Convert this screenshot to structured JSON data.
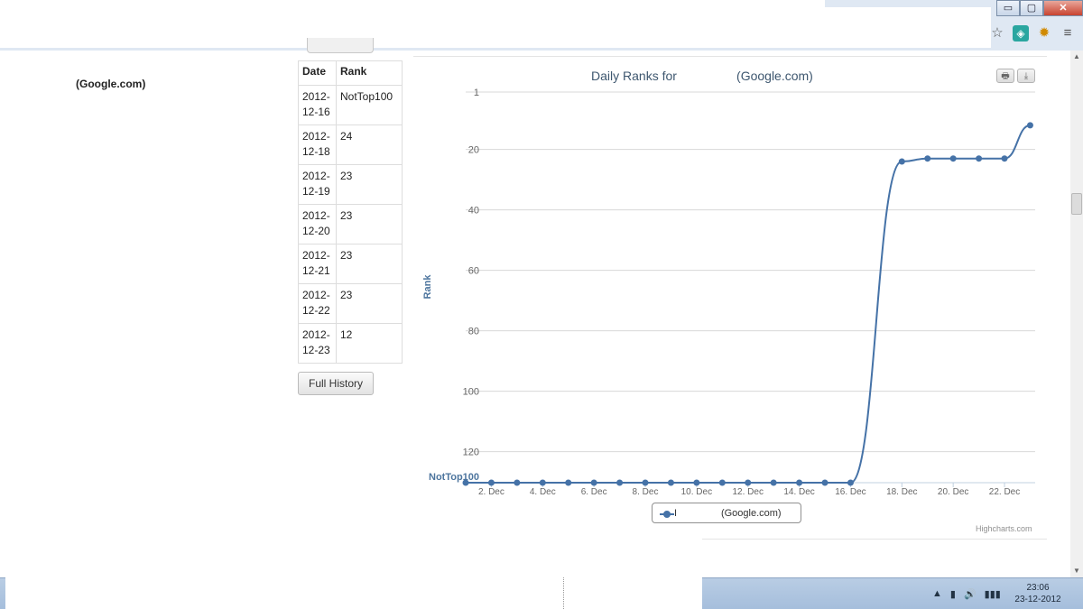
{
  "window": {
    "minimize": "▭",
    "maximize": "▢",
    "close": "✕"
  },
  "toolbar": {
    "star_icon": "☆",
    "ext1_icon": "◈",
    "ext2_icon": "✹",
    "menu_icon": "≡"
  },
  "page": {
    "title": "(Google.com)"
  },
  "table": {
    "headers": [
      "Date",
      "Rank"
    ],
    "rows": [
      [
        "2012-\n12-16",
        "NotTop100"
      ],
      [
        "2012-\n12-18",
        "24"
      ],
      [
        "2012-\n12-19",
        "23"
      ],
      [
        "2012-\n12-20",
        "23"
      ],
      [
        "2012-\n12-21",
        "23"
      ],
      [
        "2012-\n12-22",
        "23"
      ],
      [
        "2012-\n12-23",
        "12"
      ]
    ]
  },
  "buttons": {
    "full_history": "Full History"
  },
  "chart_buttons": {
    "print_icon": "🖶",
    "download_icon": "⤓"
  },
  "chart_data": {
    "type": "line",
    "title": "Daily Ranks for                 (Google.com)",
    "ylabel": "Rank",
    "y_reversed": true,
    "y_ticks": [
      "1",
      "20",
      "40",
      "60",
      "80",
      "100",
      "120"
    ],
    "y_tick_values": [
      1,
      20,
      40,
      60,
      80,
      100,
      120
    ],
    "not_top_label": "NotTop100",
    "x_tick_labels": [
      "2. Dec",
      "4. Dec",
      "6. Dec",
      "8. Dec",
      "10. Dec",
      "12. Dec",
      "14. Dec",
      "16. Dec",
      "18. Dec",
      "20. Dec",
      "22. Dec"
    ],
    "x_tick_days": [
      2,
      4,
      6,
      8,
      10,
      12,
      14,
      16,
      18,
      20,
      22
    ],
    "x_days": [
      1,
      2,
      3,
      4,
      5,
      6,
      7,
      8,
      9,
      10,
      11,
      12,
      13,
      14,
      15,
      16,
      18,
      19,
      20,
      21,
      22,
      23
    ],
    "series": [
      {
        "name": "I                (Google.com)",
        "values": [
          "NotTop100",
          "NotTop100",
          "NotTop100",
          "NotTop100",
          "NotTop100",
          "NotTop100",
          "NotTop100",
          "NotTop100",
          "NotTop100",
          "NotTop100",
          "NotTop100",
          "NotTop100",
          "NotTop100",
          "NotTop100",
          "NotTop100",
          "NotTop100",
          24,
          23,
          23,
          23,
          23,
          12
        ]
      }
    ],
    "legend_position": "bottom",
    "grid": true,
    "colors": {
      "series": "#4572a7",
      "grid": "#d8d8d8",
      "axis_label": "#4d759e"
    },
    "credits": "Highcharts.com"
  },
  "taskbar": {
    "tray_icons": [
      "▲",
      "▮",
      "🔊",
      "▮▮▮"
    ],
    "time": "23:06",
    "date": "23-12-2012"
  }
}
